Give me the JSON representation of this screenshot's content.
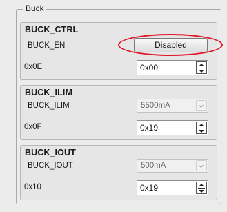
{
  "group": {
    "legend": "Buck"
  },
  "buck_ctrl": {
    "title": "BUCK_CTRL",
    "en_label": "BUCK_EN",
    "en_button": "Disabled",
    "address": "0x0E",
    "value": "0x00"
  },
  "buck_ilim": {
    "title": "BUCK_ILIM",
    "label": "BUCK_ILIM",
    "selected": "5500mA",
    "address": "0x0F",
    "value": "0x19"
  },
  "buck_iout": {
    "title": "BUCK_IOUT",
    "label": "BUCK_IOUT",
    "selected": "500mA",
    "address": "0x10",
    "value": "0x19"
  },
  "colors": {
    "annotation": "#e1182a"
  },
  "icons": {
    "spinner": "up-down-arrows-icon",
    "dropdown": "chevron-down-icon"
  }
}
